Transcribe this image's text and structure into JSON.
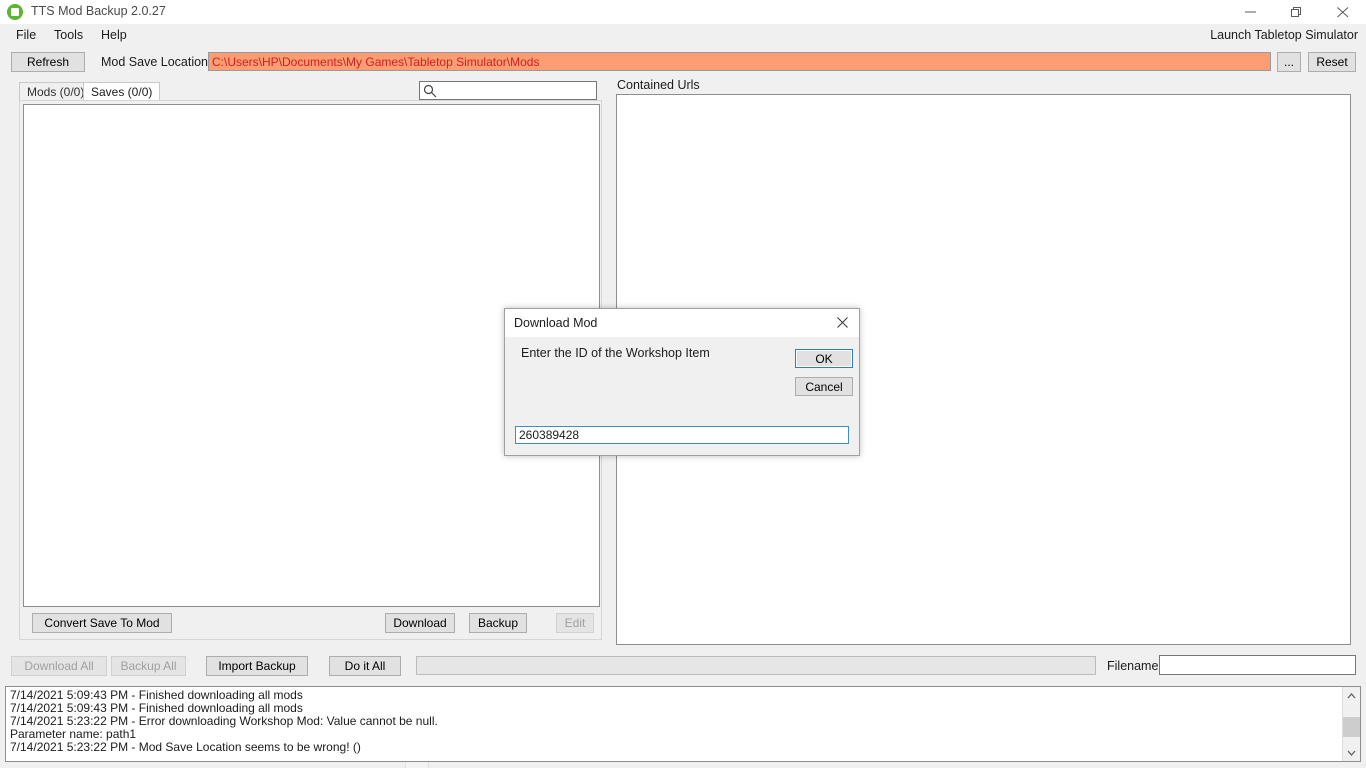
{
  "window": {
    "title": "TTS Mod Backup 2.0.27",
    "icon": "app-green-circle-icon",
    "controls": {
      "minimize": "minimize-icon",
      "maximize": "restore-icon",
      "close": "close-icon"
    }
  },
  "menu": {
    "items": [
      {
        "label": "File"
      },
      {
        "label": "Tools"
      },
      {
        "label": "Help"
      }
    ],
    "launch_label": "Launch Tabletop Simulator"
  },
  "toolbar": {
    "refresh_label": "Refresh",
    "mod_save_location_label": "Mod Save Location",
    "path_value": "C:\\Users\\HP\\Documents\\My Games\\Tabletop Simulator\\Mods",
    "path_text_color": "#d02020",
    "path_bg_color": "#fc9d73",
    "browse_label": "...",
    "reset_label": "Reset"
  },
  "tabs": [
    {
      "label": "Mods (0/0)",
      "active": false
    },
    {
      "label": "Saves (0/0)",
      "active": true
    }
  ],
  "search": {
    "value": "",
    "placeholder": "",
    "icon": "search-icon"
  },
  "left_panel": {
    "items": [],
    "buttons": {
      "convert_label": "Convert Save To Mod",
      "download_label": "Download",
      "backup_label": "Backup",
      "edit_label": "Edit"
    }
  },
  "right_panel": {
    "header": "Contained Urls",
    "items": []
  },
  "bottom_bar": {
    "download_all_label": "Download All",
    "backup_all_label": "Backup All",
    "import_backup_label": "Import Backup",
    "do_it_all_label": "Do it All",
    "progress_value": 0,
    "filename_label": "Filename",
    "filename_value": ""
  },
  "log": {
    "lines": [
      "7/14/2021 5:09:43 PM - Finished downloading all mods",
      "7/14/2021 5:09:43 PM - Finished downloading all mods",
      "7/14/2021 5:23:22 PM - Error downloading Workshop Mod: Value cannot be null.",
      "Parameter name: path1",
      "7/14/2021 5:23:22 PM - Mod Save Location seems to be wrong! ()"
    ]
  },
  "dialog": {
    "title": "Download Mod",
    "prompt": "Enter the ID of the Workshop Item",
    "ok_label": "OK",
    "cancel_label": "Cancel",
    "input_value": "260389428",
    "close_icon": "close-icon",
    "focus_color": "#3f8cc8"
  }
}
